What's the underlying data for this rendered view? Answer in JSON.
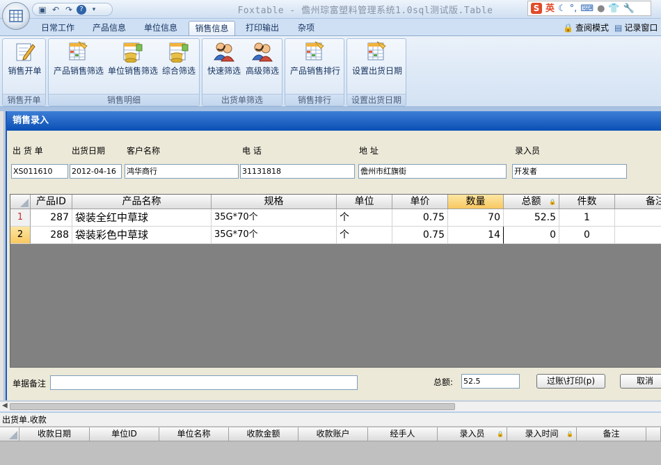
{
  "app": {
    "title": "Foxtable - 儋州琮富塑料管理系统1.0sql测试版.Table",
    "qat_icons": [
      "save-icon",
      "undo-icon",
      "redo-icon",
      "help-icon",
      "customize-icon"
    ],
    "ime": {
      "logo": "S",
      "mode": "英"
    }
  },
  "tabs": [
    {
      "label": "日常工作",
      "active": false
    },
    {
      "label": "产品信息",
      "active": false
    },
    {
      "label": "单位信息",
      "active": false
    },
    {
      "label": "销售信息",
      "active": true
    },
    {
      "label": "打印输出",
      "active": false
    },
    {
      "label": "杂项",
      "active": false
    }
  ],
  "right_links": [
    {
      "label": "查阅模式",
      "icon": "lock-icon"
    },
    {
      "label": "记录窗口",
      "icon": "window-icon"
    }
  ],
  "ribbon": {
    "groups": [
      {
        "caption": "销售开单",
        "buttons": [
          {
            "label": "销售开单",
            "icon": "edit-sheet-icon"
          }
        ]
      },
      {
        "caption": "销售明细",
        "buttons": [
          {
            "label": "产品销售筛选",
            "icon": "sheet-icon"
          },
          {
            "label": "单位销售筛选",
            "icon": "db-sheet-icon"
          },
          {
            "label": "综合筛选",
            "icon": "db-sheet-icon"
          }
        ]
      },
      {
        "caption": "出货单筛选",
        "buttons": [
          {
            "label": "快速筛选",
            "icon": "users-icon"
          },
          {
            "label": "高级筛选",
            "icon": "users-icon"
          }
        ]
      },
      {
        "caption": "销售排行",
        "buttons": [
          {
            "label": "产品销售排行",
            "icon": "sheet-icon"
          }
        ]
      },
      {
        "caption": "设置出货日期",
        "buttons": [
          {
            "label": "设置出货日期",
            "icon": "sheet-icon"
          }
        ]
      }
    ]
  },
  "form": {
    "title": "销售录入",
    "fields": [
      {
        "label": "出 货 单",
        "value": "XS011610"
      },
      {
        "label": "出货日期",
        "value": "2012-04-16"
      },
      {
        "label": "客户名称",
        "value": "鸿华商行"
      },
      {
        "label": "电  话",
        "value": "31131818"
      },
      {
        "label": "地  址",
        "value": "儋州市红旗街"
      },
      {
        "label": "录入员",
        "value": "开发者"
      }
    ],
    "grid": {
      "columns": [
        "产品ID",
        "产品名称",
        "规格",
        "单位",
        "单价",
        "数量",
        "总额",
        "件数",
        "备注"
      ],
      "selected_column": "数量",
      "rows": [
        {
          "num": "1",
          "cells": [
            "287",
            "袋装全红中草球",
            "35G*70个",
            "个",
            "0.75",
            "70",
            "52.5",
            "1",
            ""
          ]
        },
        {
          "num": "2",
          "cells": [
            "288",
            "袋装彩色中草球",
            "35G*70个",
            "个",
            "0.75",
            "14",
            "0",
            "0",
            ""
          ]
        }
      ]
    },
    "memo_label": "单据备注",
    "memo_value": "",
    "total_label": "总额:",
    "total_value": "52.5",
    "post_print_button": "过账\\打印(p)",
    "cancel_button": "取消"
  },
  "lower_panel": {
    "title": "出货单.收款",
    "columns": [
      "收款日期",
      "单位ID",
      "单位名称",
      "收款金额",
      "收款账户",
      "经手人",
      "录入员",
      "录入时间",
      "备注"
    ]
  }
}
